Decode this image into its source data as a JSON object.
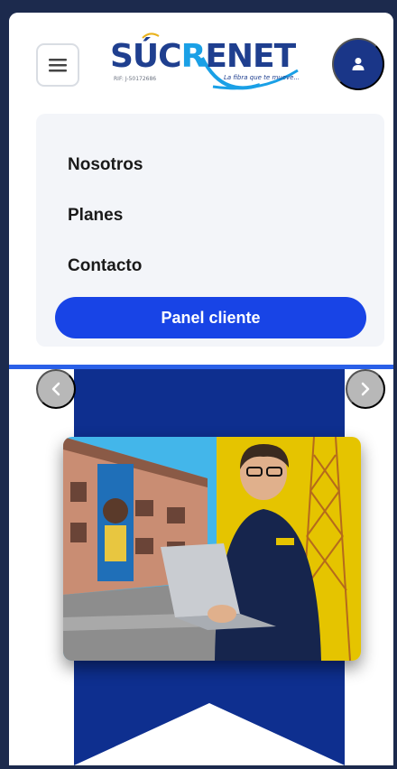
{
  "header": {
    "menu_icon": "hamburger-icon",
    "user_icon": "user-icon",
    "logo": {
      "wordmark_left": "SÚC",
      "wordmark_r": "R",
      "wordmark_right": "ENET",
      "small_text": "RIF: J-50172686",
      "tagline": "La fibra que te mueve..."
    }
  },
  "nav": {
    "items": [
      "Nosotros",
      "Planes",
      "Contacto"
    ],
    "panel_button": "Panel cliente"
  },
  "carousel": {
    "prev_icon": "chevron-left-icon",
    "next_icon": "chevron-right-icon",
    "slide_image": "promo-photo-building-and-technician-with-laptop"
  },
  "colors": {
    "brand_navy": "#1a3688",
    "accent_blue": "#1844e6",
    "ribbon_blue": "#0e2f8f",
    "slide_yellow": "#e5c400"
  }
}
